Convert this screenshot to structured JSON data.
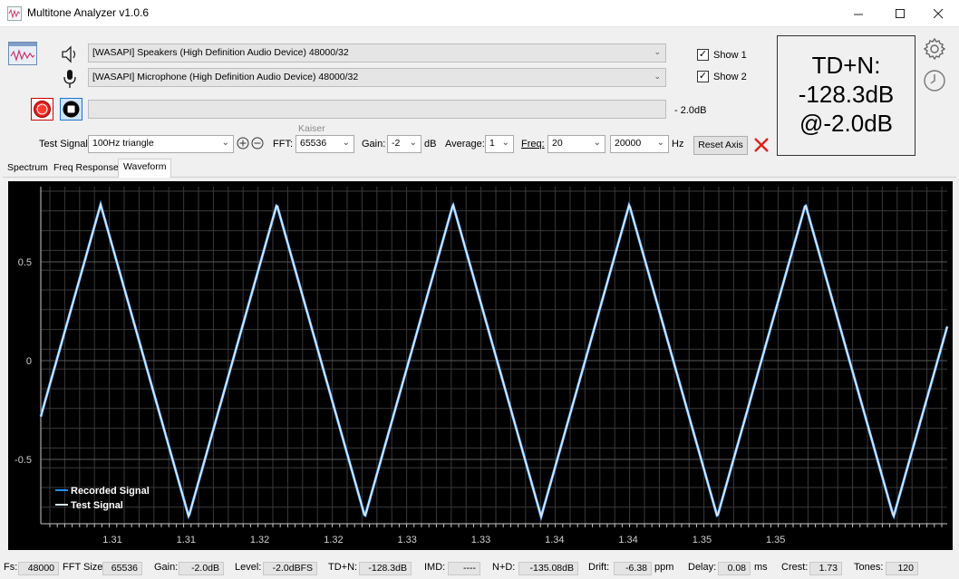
{
  "window": {
    "title": "Multitone Analyzer v1.0.6"
  },
  "output_device": "[WASAPI] Speakers (High Definition Audio Device) 48000/32",
  "input_device": "[WASAPI] Microphone (High Definition Audio Device) 48000/32",
  "show1_label": "Show 1",
  "show2_label": "Show 2",
  "level_label": "- 2.0dB",
  "td_box": {
    "line1": "TD+N:",
    "line2": "-128.3dB",
    "line3": "@-2.0dB"
  },
  "controls": {
    "test_signal_label": "Test Signal:",
    "test_signal_value": "100Hz triangle",
    "fft_label": "FFT:",
    "fft_value": "65536",
    "window_label": "Kaiser",
    "gain_label": "Gain:",
    "gain_value": "-2",
    "gain_unit": "dB",
    "average_label": "Average:",
    "average_value": "1",
    "freq_label": "Freq:",
    "freq_min": "20",
    "freq_max": "20000",
    "freq_unit": "Hz",
    "reset_axis": "Reset Axis"
  },
  "tabs": [
    "Spectrum",
    "Freq Response",
    "Waveform"
  ],
  "status_bar": {
    "fs_label": "Fs:",
    "fs_value": "48000",
    "fft_size_label": "FFT Size:",
    "fft_size_value": "65536",
    "gain_label": "Gain:",
    "gain_value": "-2.0dB",
    "level_label": "Level:",
    "level_value": "-2.0dBFS",
    "tdn_label": "TD+N:",
    "tdn_value": "-128.3dB",
    "imd_label": "IMD:",
    "imd_value": "----",
    "nd_label": "N+D:",
    "nd_value": "-135.08dB",
    "drift_label": "Drift:",
    "drift_value": "-6.38",
    "drift_unit": "ppm",
    "delay_label": "Delay:",
    "delay_value": "0.08",
    "delay_unit": "ms",
    "crest_label": "Crest:",
    "crest_value": "1.73",
    "tones_label": "Tones:",
    "tones_value": "120"
  },
  "colors": {
    "plot_bg": "#000000",
    "grid": "#3a3a3a",
    "grid_major": "#5a5a5a",
    "recorded": "#1e90ff",
    "test": "#d8e4f0",
    "axis_text": "#d0d0d0"
  },
  "chart_data": {
    "type": "line",
    "ylim": [
      -0.8,
      0.8
    ],
    "yticks": [
      0.5,
      0,
      -0.5
    ],
    "ytick_labels": [
      "0.5",
      "0",
      "-0.5"
    ],
    "xtick_labels": [
      "1.31",
      "1.31",
      "1.32",
      "1.32",
      "1.33",
      "1.33",
      "1.34",
      "1.34",
      "1.35",
      "1.35"
    ],
    "legend": {
      "placement": "bottom-left",
      "entries": [
        "Recorded Signal",
        "Test Signal"
      ]
    },
    "grid": true,
    "series": [
      {
        "name": "Recorded Signal",
        "waveform": "triangle",
        "frequency_hz": 100,
        "amplitude": 0.79
      },
      {
        "name": "Test Signal",
        "waveform": "triangle",
        "frequency_hz": 100,
        "amplitude": 0.79
      }
    ],
    "peaks_visible": 5,
    "troughs_visible": 5
  }
}
